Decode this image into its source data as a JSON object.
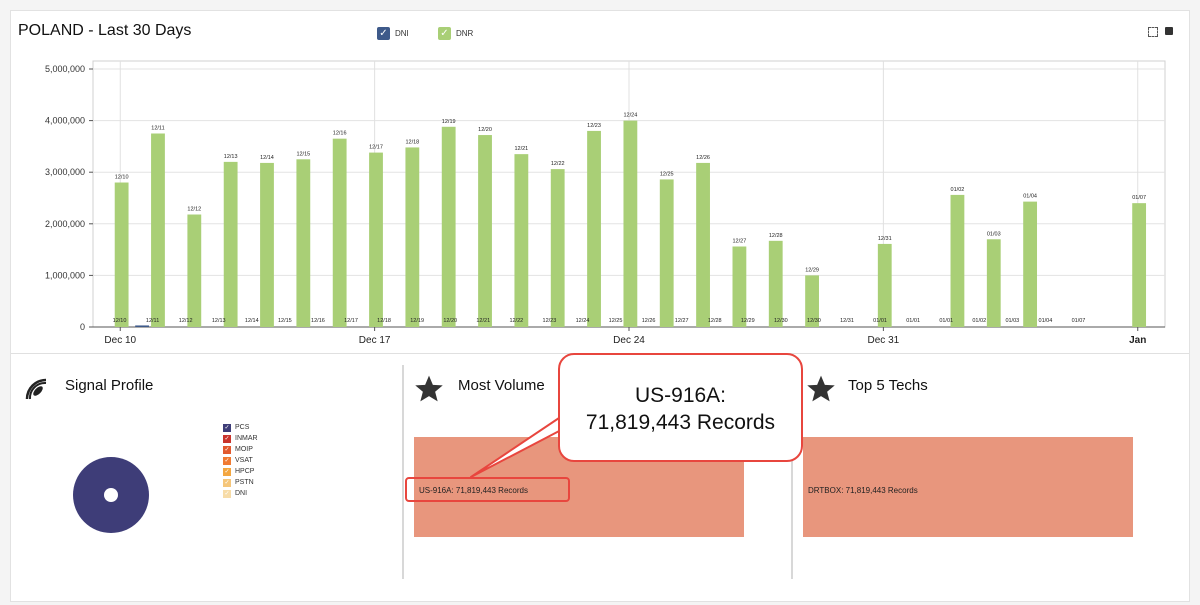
{
  "header": {
    "title": "POLAND - Last 30 Days",
    "legend": [
      {
        "label": "DNI",
        "color": "#3e5a8a"
      },
      {
        "label": "DNR",
        "color": "#a9cf76"
      }
    ]
  },
  "chart_data": {
    "type": "bar",
    "title": "POLAND - Last 30 Days",
    "xlabel": "",
    "ylabel": "",
    "ylim": [
      0,
      5000000
    ],
    "yticks": [
      "0",
      "1,000,000",
      "2,000,000",
      "3,000,000",
      "4,000,000",
      "5,000,000"
    ],
    "xticks": [
      "Dec 10",
      "Dec 17",
      "Dec 24",
      "Dec 31",
      "Jan"
    ],
    "grid": true,
    "legend_position": "top",
    "categories": [
      "12/10",
      "12/11",
      "12/12",
      "12/13",
      "12/14",
      "12/15",
      "12/16",
      "12/17",
      "12/18",
      "12/19",
      "12/20",
      "12/21",
      "12/22",
      "12/23",
      "12/24",
      "12/25",
      "12/26",
      "12/27",
      "12/28",
      "12/29",
      "12/30",
      "12/31",
      "01/01",
      "01/02",
      "01/03",
      "01/04",
      "01/05",
      "01/06",
      "01/07"
    ],
    "series": [
      {
        "name": "DNI",
        "color": "#3e5a8a",
        "values": [
          0,
          30000,
          0,
          0,
          0,
          0,
          0,
          0,
          0,
          0,
          0,
          0,
          0,
          0,
          0,
          0,
          0,
          0,
          0,
          0,
          0,
          0,
          0,
          0,
          0,
          0,
          0,
          0,
          0
        ]
      },
      {
        "name": "DNR",
        "color": "#a9cf76",
        "values": [
          2800000,
          3750000,
          2180000,
          3200000,
          3180000,
          3250000,
          3650000,
          3380000,
          3480000,
          3880000,
          3720000,
          3350000,
          3060000,
          3800000,
          4000000,
          2860000,
          3180000,
          1560000,
          1670000,
          1000000,
          0,
          1610000,
          0,
          2560000,
          1700000,
          2430000,
          0,
          0,
          2400000
        ]
      }
    ],
    "bar_labels": [
      "12/10",
      "12/11",
      "12/12",
      "12/13",
      "12/14",
      "12/15",
      "12/16",
      "12/17",
      "12/18",
      "12/19",
      "12/20",
      "12/21",
      "12/22",
      "12/23",
      "12/24",
      "12/25",
      "12/26",
      "12/27",
      "12/28",
      "12/29",
      "",
      "12/31",
      "",
      "01/02",
      "01/03",
      "01/04",
      "",
      "",
      "01/07"
    ],
    "bottom_labels": [
      "12/10",
      "12/11",
      "12/12",
      "12/13",
      "12/14",
      "12/15",
      "12/16",
      "12/17",
      "12/18",
      "12/19",
      "12/20",
      "12/21",
      "12/22",
      "12/23",
      "12/24",
      "12/25",
      "12/26",
      "12/27",
      "12/28",
      "12/29",
      "12/30",
      "12/30",
      "12/31",
      "01/01",
      "01/01",
      "01/01",
      "01/02",
      "01/03",
      "01/04",
      "01/07"
    ]
  },
  "signal_profile": {
    "title": "Signal Profile",
    "pie_color": "#3e3d78",
    "legend": [
      {
        "label": "PCS",
        "color": "#3e3d78"
      },
      {
        "label": "INMAR",
        "color": "#c9342c"
      },
      {
        "label": "MOIP",
        "color": "#e25a2f"
      },
      {
        "label": "VSAT",
        "color": "#f07a32"
      },
      {
        "label": "HPCP",
        "color": "#f3a63f"
      },
      {
        "label": "PSTN",
        "color": "#f5c67a"
      },
      {
        "label": "DNI",
        "color": "#f7dca8"
      }
    ]
  },
  "most_volume": {
    "title": "Most Volume",
    "record_label": "US-916A: 71,819,443 Records",
    "callout_line1": "US-916A:",
    "callout_line2": "71,819,443 Records"
  },
  "top_techs": {
    "title": "Top 5 Techs",
    "record_label": "DRTBOX: 71,819,443 Records"
  }
}
